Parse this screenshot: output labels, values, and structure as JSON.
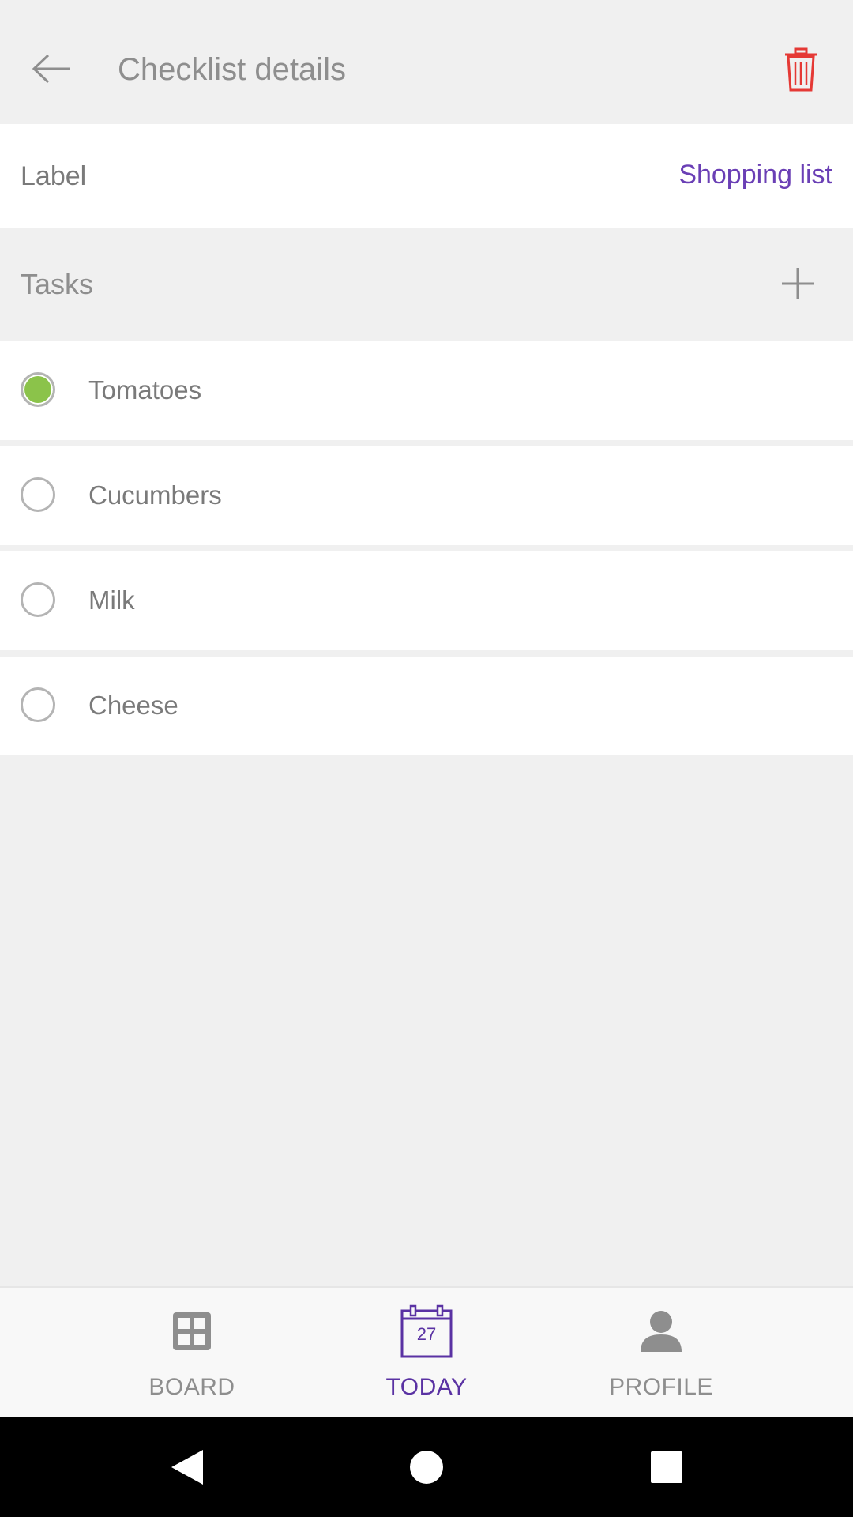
{
  "app_bar": {
    "title": "Checklist details",
    "back_icon": "arrow-left-icon",
    "delete_icon": "trash-icon",
    "delete_color": "#e53935"
  },
  "label_row": {
    "key": "Label",
    "value": "Shopping list",
    "value_color": "#6a3fb5"
  },
  "tasks": {
    "title": "Tasks",
    "add_icon": "plus-icon",
    "items": [
      {
        "label": "Tomatoes",
        "checked": true
      },
      {
        "label": "Cucumbers",
        "checked": false
      },
      {
        "label": "Milk",
        "checked": false
      },
      {
        "label": "Cheese",
        "checked": false
      }
    ],
    "checked_color": "#8bc34a"
  },
  "bottom_nav": {
    "items": [
      {
        "label": "BOARD",
        "icon": "board-grid-icon",
        "active": false
      },
      {
        "label": "TODAY",
        "icon": "calendar-icon",
        "calendar_day": "27",
        "active": true
      },
      {
        "label": "PROFILE",
        "icon": "person-icon",
        "active": false
      }
    ],
    "active_color": "#5a32a3"
  },
  "system_nav": {
    "back_icon": "triangle-back-icon",
    "home_icon": "circle-home-icon",
    "recents_icon": "square-recents-icon"
  }
}
